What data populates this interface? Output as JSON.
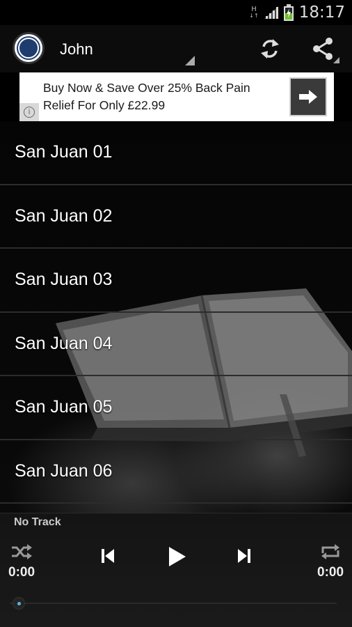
{
  "status_bar": {
    "network_type": "H",
    "network_arrows": "↓↑",
    "time": "18:17"
  },
  "action_bar": {
    "book_title": "John",
    "refresh_icon": "refresh-icon",
    "share_icon": "share-icon"
  },
  "ad": {
    "text": "Buy Now & Save Over 25% Back Pain Relief For Only £22.99",
    "info_glyph": "i"
  },
  "chapters": [
    {
      "label": "San Juan 01"
    },
    {
      "label": "San Juan 02"
    },
    {
      "label": "San Juan 03"
    },
    {
      "label": "San Juan 04"
    },
    {
      "label": "San Juan 05"
    },
    {
      "label": "San Juan 06"
    }
  ],
  "player": {
    "now_playing": "No Track",
    "elapsed": "0:00",
    "total": "0:00",
    "progress": 0
  },
  "colors": {
    "seek_accent": "#5ab4e0",
    "battery_charge": "#6ec02a"
  }
}
